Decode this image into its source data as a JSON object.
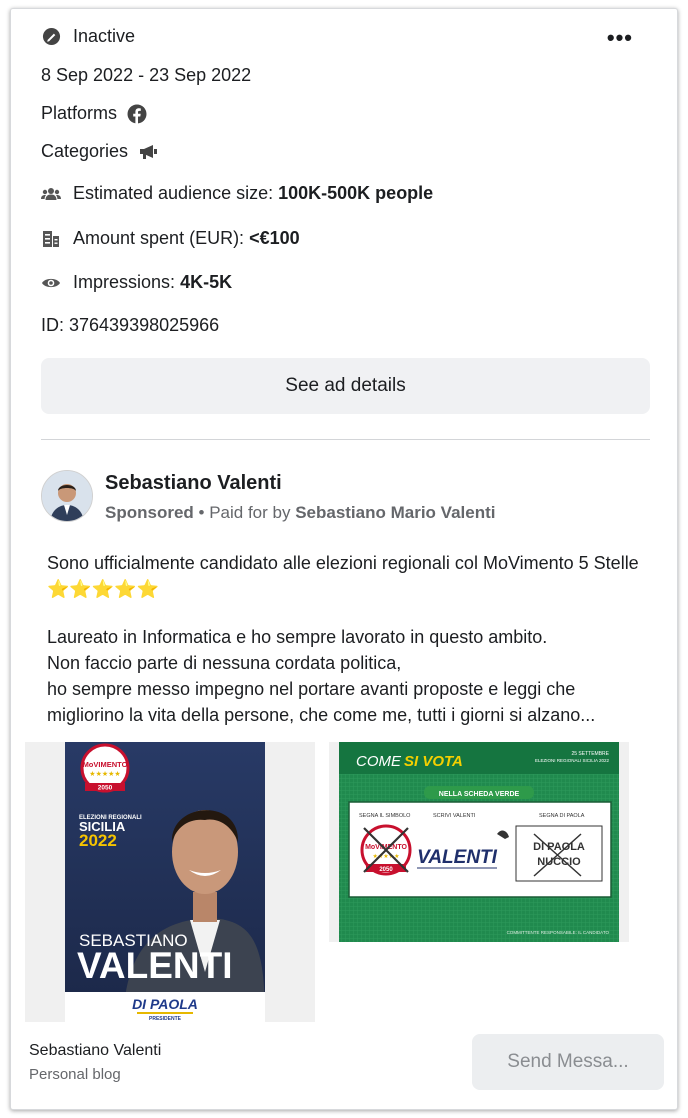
{
  "status": {
    "label": "Inactive",
    "icon": "inactive-icon"
  },
  "more_icon": "more-options-icon",
  "dates": "8 Sep 2022 - 23 Sep 2022",
  "platforms": {
    "label": "Platforms",
    "icon": "facebook-icon"
  },
  "categories": {
    "label": "Categories",
    "icon": "megaphone-icon"
  },
  "audience": {
    "label": "Estimated audience size:",
    "value": "100K-500K people",
    "icon": "people-icon"
  },
  "spent": {
    "label": "Amount spent (EUR):",
    "value": "<€100",
    "icon": "money-icon"
  },
  "impressions": {
    "label": "Impressions:",
    "value": "4K-5K",
    "icon": "eye-icon"
  },
  "ad_id": "ID: 376439398025966",
  "see_details_label": "See ad details",
  "post": {
    "page_name": "Sebastiano Valenti",
    "sponsored": "Sponsored",
    "paid_for_prefix": " • Paid for by ",
    "paid_for_name": "Sebastiano Mario Valenti",
    "text_line1": "Sono ufficialmente candidato alle elezioni regionali col MoVimento 5 Stelle ⭐⭐⭐⭐⭐",
    "text_para2": [
      "Laureato in Informatica e ho sempre lavorato in questo ambito.",
      "Non faccio parte di nessuna cordata politica,",
      "ho sempre messo impegno nel portare avanti proposte e leggi che",
      "migliorino la vita della persone, che come me, tutti i giorni si alzano..."
    ]
  },
  "poster": {
    "logo_top": "MoVIMENTO",
    "logo_year": "2050",
    "subtitle": "ELEZIONI REGIONALI",
    "region": "SICILIA",
    "year": "2022",
    "first_name": "SEBASTIANO",
    "last_name": "VALENTI",
    "footer_name": "DI PAOLA",
    "footer_role": "PRESIDENTE"
  },
  "ballot": {
    "title_a": "COME ",
    "title_b": "SI VOTA",
    "date_top": "25 SETTEMBRE",
    "date_sub": "ELEZIONI REGIONALI SICILIA 2022",
    "banner": "NELLA SCHEDA VERDE",
    "col1_label": "SEGNA IL SIMBOLO",
    "col2_label": "SCRIVI VALENTI",
    "col3_label": "SEGNA DI PAOLA",
    "logo_text": "MoVIMENTO",
    "logo_year": "2050",
    "write_in": "VALENTI",
    "cross_line1": "DI PAOLA",
    "cross_line2": "NUCCIO",
    "footnote": "COMMITTENTE RESPONSABILE: IL CANDIDATO"
  },
  "footer": {
    "name": "Sebastiano Valenti",
    "subtitle": "Personal blog",
    "send_label": "Send Messa..."
  }
}
